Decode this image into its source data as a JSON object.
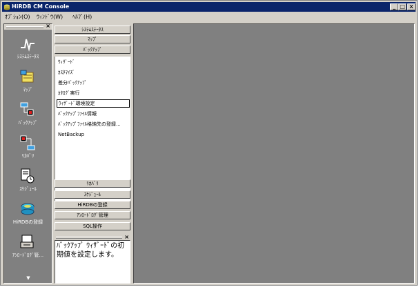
{
  "window": {
    "title": "HiRDB CM Console"
  },
  "menu": [
    "ｵﾌﾟｼｮﾝ(O)",
    "ｳｨﾝﾄﾞｳ(W)",
    "ﾍﾙﾌﾟ(H)"
  ],
  "left_buttons": [
    {
      "label": "ｼｽﾃﾑｽﾃｰﾀｽ",
      "icon": "system-status-icon"
    },
    {
      "label": "ﾏｯﾌﾟ",
      "icon": "map-icon"
    },
    {
      "label": "ﾊﾞｯｸｱｯﾌﾟ",
      "icon": "backup-icon"
    },
    {
      "label": "ﾘｶﾊﾞﾘ",
      "icon": "recovery-icon"
    },
    {
      "label": "ｽｹｼﾞｭｰﾙ",
      "icon": "schedule-icon"
    },
    {
      "label": "HiRDBの登録",
      "icon": "hirdb-register-icon"
    },
    {
      "label": "ｱﾝﾛｰﾄﾞﾛｸﾞ管...",
      "icon": "unload-log-icon"
    }
  ],
  "categories_top": [
    "ｼｽﾃﾑｽﾃｰﾀｽ",
    "ﾏｯﾌﾟ",
    "ﾊﾞｯｸｱｯﾌﾟ"
  ],
  "backup_items": [
    "ｳｨｻﾞｰﾄﾞ",
    "ｶｽﾀﾏｲｽﾞ",
    "差分ﾊﾞｯｸｱｯﾌﾟ",
    "ｶﾀﾛｸﾞ実行",
    "ｳｨｻﾞｰﾄﾞ環境設定",
    "ﾊﾞｯｸｱｯﾌﾟﾌｧｲﾙ情報",
    "ﾊﾞｯｸｱｯﾌﾟﾌｧｲﾙ格納先の登録...",
    "NetBackup"
  ],
  "selected_item_index": 4,
  "categories_bottom": [
    "ﾘｶﾊﾞﾘ",
    "ｽｹｼﾞｭｰﾙ",
    "HiRDBの登録",
    "ｱﾝﾛｰﾄﾞﾛｸﾞ管理",
    "SQL操作"
  ],
  "description": "ﾊﾞｯｸｱｯﾌﾟ ｳｨｻﾞｰﾄﾞの初期値を設定します。",
  "colors": {
    "titlebar": "#0a246a",
    "face": "#d4d0c8",
    "workspace": "#808080"
  }
}
